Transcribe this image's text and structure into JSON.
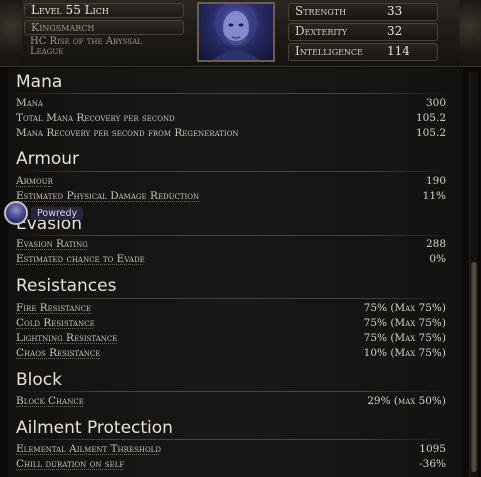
{
  "header": {
    "level": "Level 55 Lich",
    "league_name": "Kingsmarch",
    "league_desc_1": "HC Rise of the Abyssal",
    "league_desc_2": "League",
    "attributes": [
      {
        "label": "Strength",
        "value": "33"
      },
      {
        "label": "Dexterity",
        "value": "32"
      },
      {
        "label": "Intelligence",
        "value": "114"
      }
    ]
  },
  "sections": {
    "mana": {
      "title": "Mana",
      "rows": [
        {
          "label": "Mana",
          "value": "300"
        },
        {
          "label": "Total Mana Recovery per second",
          "value": "105.2"
        },
        {
          "label": "Mana Recovery per second from Regeneration",
          "value": "105.2"
        }
      ]
    },
    "armour": {
      "title": "Armour",
      "rows": [
        {
          "label": "Armour",
          "value": "190"
        },
        {
          "label": "Estimated Physical Damage Reduction",
          "value": "11%"
        }
      ]
    },
    "evasion": {
      "title": "Evasion",
      "rows": [
        {
          "label": "Evasion Rating",
          "value": "288"
        },
        {
          "label": "Estimated chance to Evade",
          "value": "0%"
        }
      ]
    },
    "resistances": {
      "title": "Resistances",
      "rows": [
        {
          "label": "Fire Resistance",
          "value": "75% (Max 75%)"
        },
        {
          "label": "Cold Resistance",
          "value": "75% (Max 75%)"
        },
        {
          "label": "Lightning Resistance",
          "value": "75% (Max 75%)"
        },
        {
          "label": "Chaos Resistance",
          "value": "10% (Max 75%)"
        }
      ]
    },
    "block": {
      "title": "Block",
      "rows": [
        {
          "label": "Block Chance",
          "value": "29% (max 50%)"
        }
      ]
    },
    "ailment": {
      "title": "Ailment Protection",
      "rows": [
        {
          "label": "Elemental Ailment Threshold",
          "value": "1095"
        },
        {
          "label": "Chill duration on self",
          "value": "-36%"
        }
      ]
    }
  },
  "user_chip": {
    "name": "Powredy"
  }
}
